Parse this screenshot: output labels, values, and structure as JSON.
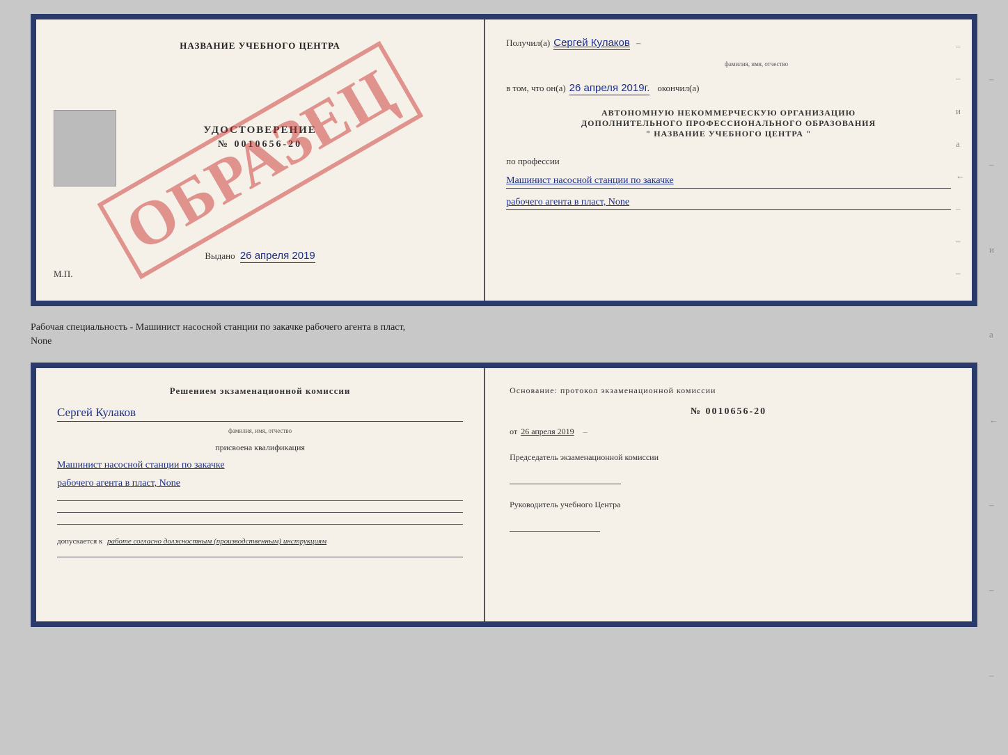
{
  "top_doc": {
    "left": {
      "center_title": "НАЗВАНИЕ УЧЕБНОГО ЦЕНТРА",
      "photo_alt": "фото",
      "udost_title": "УДОСТОВЕРЕНИЕ",
      "udost_number": "№ 0010656-20",
      "vydano_label": "Выдано",
      "vydano_date": "26 апреля 2019",
      "mp_label": "М.П.",
      "obrazets": "ОБРАЗЕЦ"
    },
    "right": {
      "poluchil_label": "Получил(а)",
      "poluchil_name": "Сергей Кулаков",
      "familiya_hint": "фамилия, имя, отчество",
      "vtom_label": "в том, что он(а)",
      "vtom_date": "26 апреля 2019г.",
      "okonchil_label": "окончил(а)",
      "org_line1": "АВТОНОМНУЮ НЕКОММЕРЧЕСКУЮ ОРГАНИЗАЦИЮ",
      "org_line2": "ДОПОЛНИТЕЛЬНОГО ПРОФЕССИОНАЛЬНОГО ОБРАЗОВАНИЯ",
      "org_line3": "\"   НАЗВАНИЕ УЧЕБНОГО ЦЕНТРА   \"",
      "po_professii": "по профессии",
      "profession_line1": "Машинист насосной станции по закачке",
      "profession_line2": "рабочего агента в пласт, None"
    }
  },
  "separator": {
    "text_line1": "Рабочая специальность - Машинист насосной станции по закачке рабочего агента в пласт,",
    "text_line2": "None"
  },
  "bottom_doc": {
    "left": {
      "komissia_title": "Решением экзаменационной комиссии",
      "name": "Сергей Кулаков",
      "familiya_hint": "фамилия, имя, отчество",
      "prisvoena": "присвоена квалификация",
      "qualification_line1": "Машинист насосной станции по закачке",
      "qualification_line2": "рабочего агента в пласт, None",
      "dopuskaetsya_label": "допускается к",
      "dopuskaetsya_text": "работе согласно должностным (производственным) инструкциям"
    },
    "right": {
      "osnov_label": "Основание: протокол экзаменационной комиссии",
      "protokol_number": "№ 0010656-20",
      "ot_label": "от",
      "ot_date": "26 апреля 2019",
      "chairman_label": "Председатель экзаменационной комиссии",
      "rukovoditel_label": "Руководитель учебного Центра"
    }
  }
}
